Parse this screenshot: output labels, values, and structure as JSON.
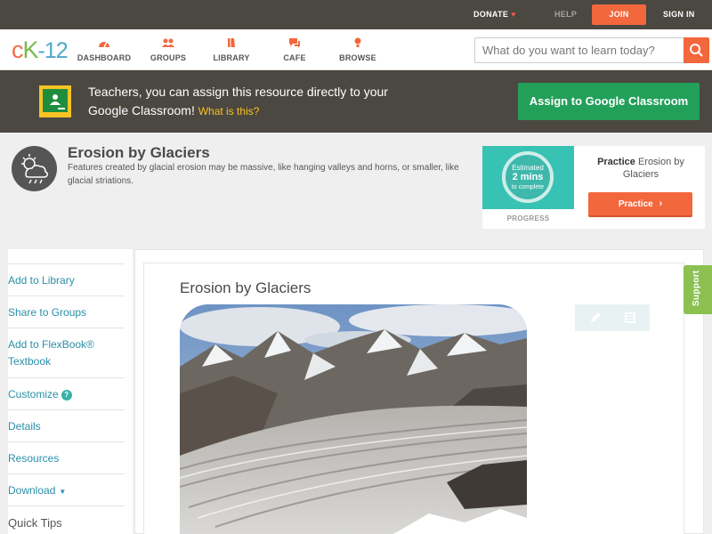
{
  "topbar": {
    "donate": "DONATE",
    "help": "HELP",
    "join": "JOIN",
    "signin": "SIGN IN"
  },
  "brand": {
    "c": "c",
    "k": "K",
    "n": "-12",
    "accent": "#f3673c"
  },
  "nav": {
    "items": [
      {
        "label": "DASHBOARD",
        "icon": "dashboard-icon"
      },
      {
        "label": "GROUPS",
        "icon": "groups-icon"
      },
      {
        "label": "LIBRARY",
        "icon": "library-icon"
      },
      {
        "label": "CAFE",
        "icon": "cafe-icon"
      },
      {
        "label": "BROWSE",
        "icon": "browse-icon"
      }
    ]
  },
  "search": {
    "placeholder": "What do you want to learn today?"
  },
  "banner": {
    "text": "Teachers, you can assign this resource directly to your Google Classroom!",
    "what": "What is this?",
    "button": "Assign to Google Classroom"
  },
  "topic": {
    "title": "Erosion by Glaciers",
    "description": "Features created by glacial erosion may be massive, like hanging valleys and horns, or smaller, like glacial striations."
  },
  "practice": {
    "estimated": "Estimated",
    "mins": "2 mins",
    "to_complete": "to complete",
    "progress": "PROGRESS",
    "title_bold": "Practice",
    "title_rest": "Erosion by Glaciers",
    "button": "Practice"
  },
  "sidebar": {
    "items": [
      "Add to Library",
      "Share to Groups",
      "Add to FlexBook® Textbook",
      "Customize",
      "Details",
      "Resources",
      "Download",
      "Quick Tips"
    ]
  },
  "content": {
    "title": "Erosion by Glaciers"
  },
  "support": "Support"
}
